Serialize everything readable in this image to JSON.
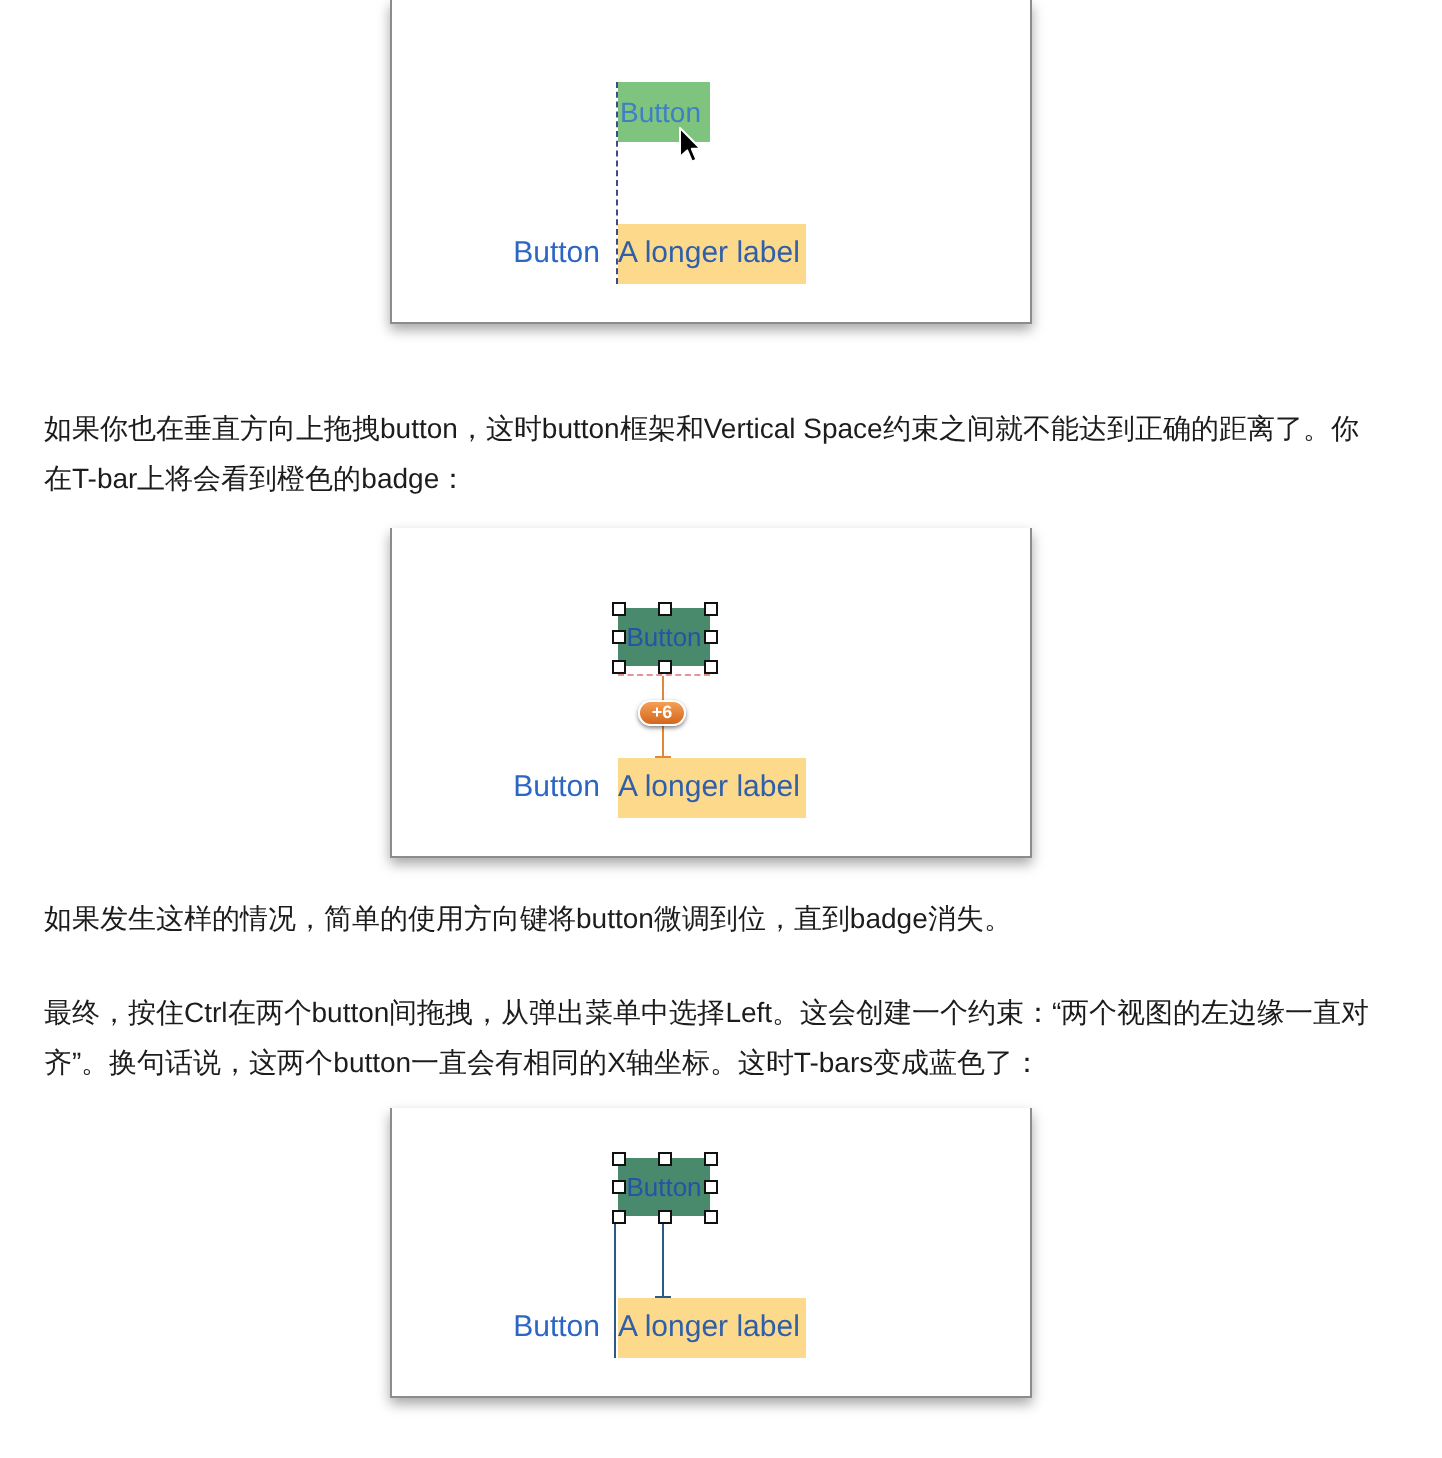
{
  "content": [
    {
      "kind": "figure",
      "dragging": true,
      "selected": false,
      "misplaced": false,
      "aligned": false,
      "top_button": "Button",
      "left_label": "Button",
      "long_label": "A longer label"
    },
    {
      "kind": "paragraph",
      "text": "如果你也在垂直方向上拖拽button，这时button框架和Vertical Space约束之间就不能达到正确的距离了。你在T-bar上将会看到橙色的badge："
    },
    {
      "kind": "figure",
      "dragging": false,
      "selected": true,
      "misplaced": true,
      "aligned": false,
      "top_button": "Button",
      "badge": "+6",
      "left_label": "Button",
      "long_label": "A longer label"
    },
    {
      "kind": "paragraph",
      "text": "如果发生这样的情况，简单的使用方向键将button微调到位，直到badge消失。"
    },
    {
      "kind": "paragraph",
      "text": "最终，按住Ctrl在两个button间拖拽，从弹出菜单中选择Left。这会创建一个约束：“两个视图的左边缘一直对齐”。换句话说，这两个button一直会有相同的X轴坐标。这时T-bars变成蓝色了："
    },
    {
      "kind": "figure",
      "dragging": false,
      "selected": true,
      "misplaced": false,
      "aligned": true,
      "top_button": "Button",
      "left_label": "Button",
      "long_label": "A longer label"
    }
  ]
}
